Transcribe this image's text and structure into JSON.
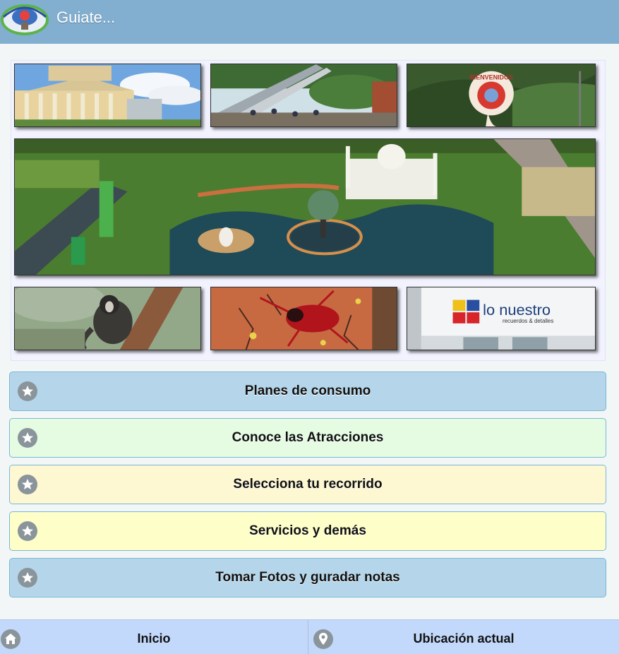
{
  "header": {
    "title": "Guiate..."
  },
  "gallery": {
    "photos": [
      "hotel-photo",
      "slide-photo",
      "bienvenidos-sign-photo",
      "aerial-park-photo",
      "monkey-photo",
      "insect-mural-photo",
      "store-photo"
    ],
    "store_sign": {
      "name": "lo nuestro",
      "tagline": "recuerdos & detalles"
    },
    "welcome_sign": "BIENVENIDOS"
  },
  "menu": {
    "items": [
      {
        "label": "Planes de consumo",
        "color": "#b5d6ea"
      },
      {
        "label": "Conoce las Atracciones",
        "color": "#e5fce3"
      },
      {
        "label": "Selecciona tu recorrido",
        "color": "#fdf7d2"
      },
      {
        "label": "Servicios y demás",
        "color": "#fefec8"
      },
      {
        "label": "Tomar Fotos y guradar notas",
        "color": "#b5d6ea"
      }
    ],
    "icon": "star-icon"
  },
  "footer": {
    "home_label": "Inicio",
    "location_label": "Ubicación actual"
  }
}
